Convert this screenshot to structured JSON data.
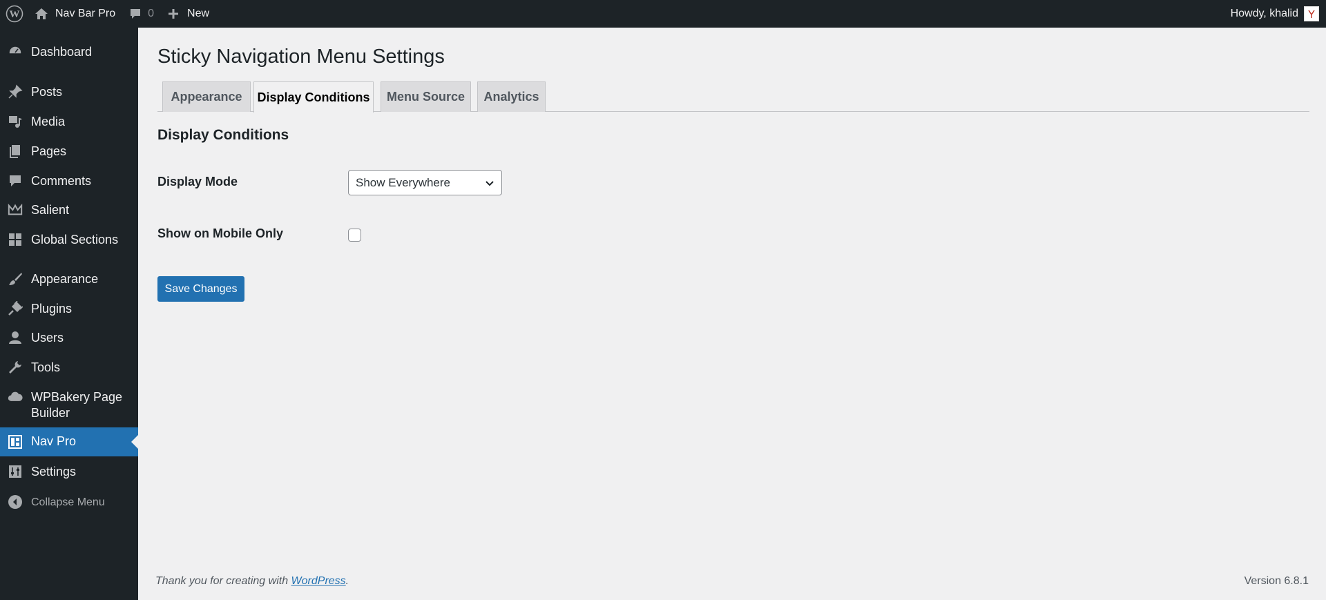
{
  "adminbar": {
    "site_name": "Nav Bar Pro",
    "comments_count": "0",
    "new_label": "New",
    "howdy": "Howdy, khalid"
  },
  "sidebar": {
    "items": [
      {
        "label": "Dashboard",
        "icon": "dashboard-icon"
      },
      {
        "label": "Posts",
        "icon": "pin-icon"
      },
      {
        "label": "Media",
        "icon": "media-icon"
      },
      {
        "label": "Pages",
        "icon": "pages-icon"
      },
      {
        "label": "Comments",
        "icon": "comment-icon"
      },
      {
        "label": "Salient",
        "icon": "crown-icon"
      },
      {
        "label": "Global Sections",
        "icon": "grid-icon"
      },
      {
        "label": "Appearance",
        "icon": "brush-icon"
      },
      {
        "label": "Plugins",
        "icon": "plug-icon"
      },
      {
        "label": "Users",
        "icon": "user-icon"
      },
      {
        "label": "Tools",
        "icon": "wrench-icon"
      },
      {
        "label": "WPBakery Page Builder",
        "icon": "cloud-icon"
      },
      {
        "label": "Nav Pro",
        "icon": "layout-icon",
        "current": true
      },
      {
        "label": "Settings",
        "icon": "sliders-icon"
      }
    ],
    "collapse_label": "Collapse Menu"
  },
  "main": {
    "title": "Sticky Navigation Menu Settings",
    "tabs": [
      {
        "label": "Appearance",
        "active": false
      },
      {
        "label": "Display Conditions",
        "active": true
      },
      {
        "label": "Menu Source",
        "active": false
      },
      {
        "label": "Analytics",
        "active": false
      }
    ],
    "section_title": "Display Conditions",
    "display_mode": {
      "label": "Display Mode",
      "value": "Show Everywhere"
    },
    "mobile_only": {
      "label": "Show on Mobile Only",
      "checked": false
    },
    "save_label": "Save Changes"
  },
  "footer": {
    "thanks_prefix": "Thank you for creating with ",
    "thanks_link": "WordPress",
    "thanks_suffix": ".",
    "version": "Version 6.8.1"
  },
  "colors": {
    "admin_dark": "#1d2327",
    "accent": "#2271b1",
    "background": "#f0f0f1"
  }
}
